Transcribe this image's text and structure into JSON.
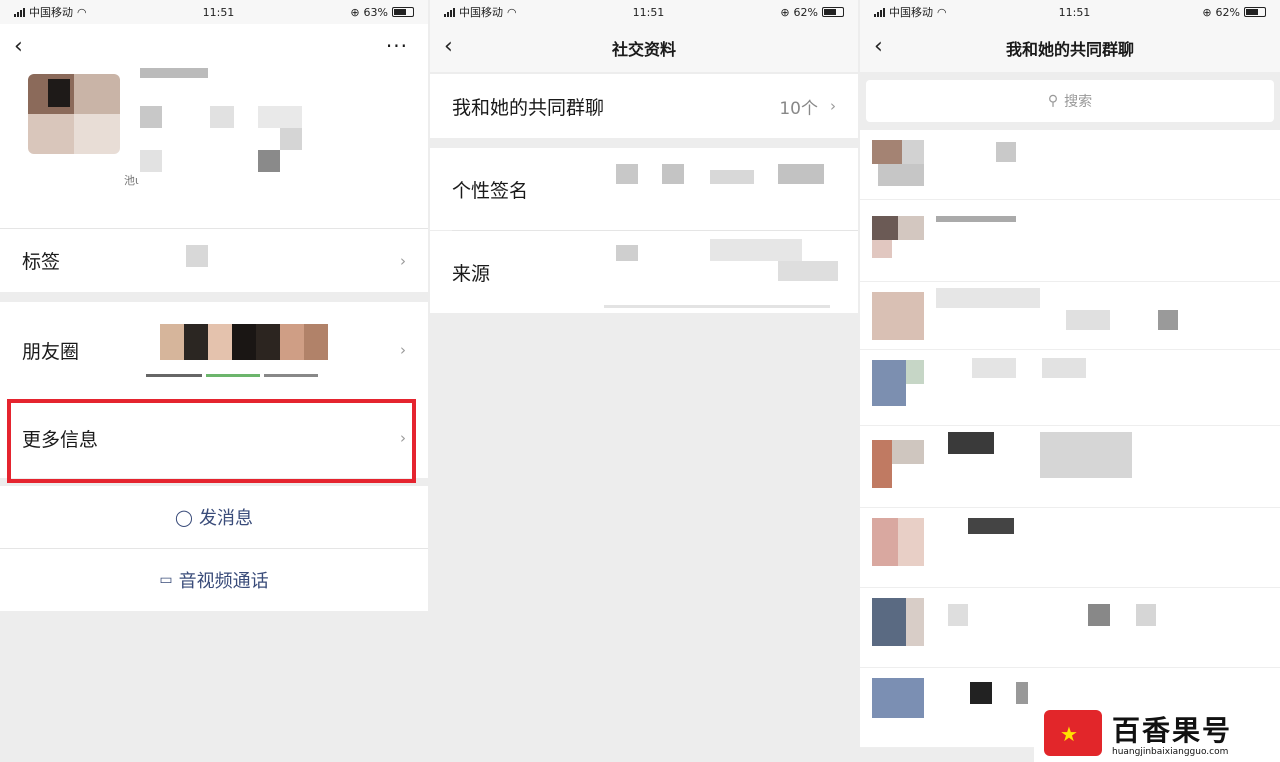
{
  "status": {
    "carrier": "中国移动",
    "time": "11:51",
    "battery_1": "63%",
    "battery_2": "62%",
    "battery_3": "62%"
  },
  "panel1": {
    "profile_remark": "池ι",
    "rows": {
      "tags": "标签",
      "moments": "朋友圈",
      "more_info": "更多信息"
    },
    "actions": {
      "message": "发消息",
      "call": "音视频通话"
    }
  },
  "panel2": {
    "title": "社交资料",
    "common_groups_label": "我和她的共同群聊",
    "common_groups_count": "10个",
    "signature_label": "个性签名",
    "source_label": "来源"
  },
  "panel3": {
    "title": "我和她的共同群聊",
    "search_placeholder": "搜索"
  },
  "watermark": {
    "brand": "百香果号",
    "url": "huangjinbaixiangguo.com"
  },
  "colors": {
    "highlight": "#e5242f",
    "action_text": "#3a4c7a"
  },
  "icons": [
    "back-icon",
    "more-icon",
    "chevron-right-icon",
    "chat-bubble-icon",
    "video-icon",
    "search-icon",
    "wifi-icon",
    "signal-icon",
    "battery-icon"
  ]
}
